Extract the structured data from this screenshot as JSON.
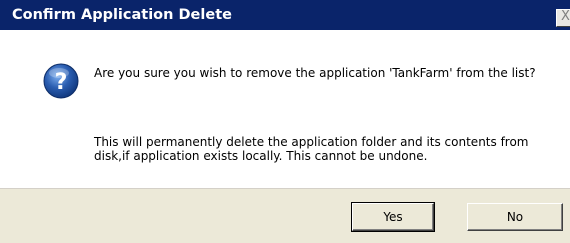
{
  "dialog": {
    "title": "Confirm Application Delete",
    "close_label": "X",
    "icon": "question-icon",
    "message_line1": "Are you sure you wish to remove the application 'TankFarm' from the list?",
    "message_line2": "This will permanently delete the application folder and its contents from disk,if application exists locally. This cannot be undone.",
    "buttons": {
      "yes_label": "Yes",
      "no_label": "No"
    }
  },
  "colors": {
    "titlebar": "#0a246a",
    "icon_blue": "#2a5db0",
    "button_face": "#ece9d8"
  }
}
